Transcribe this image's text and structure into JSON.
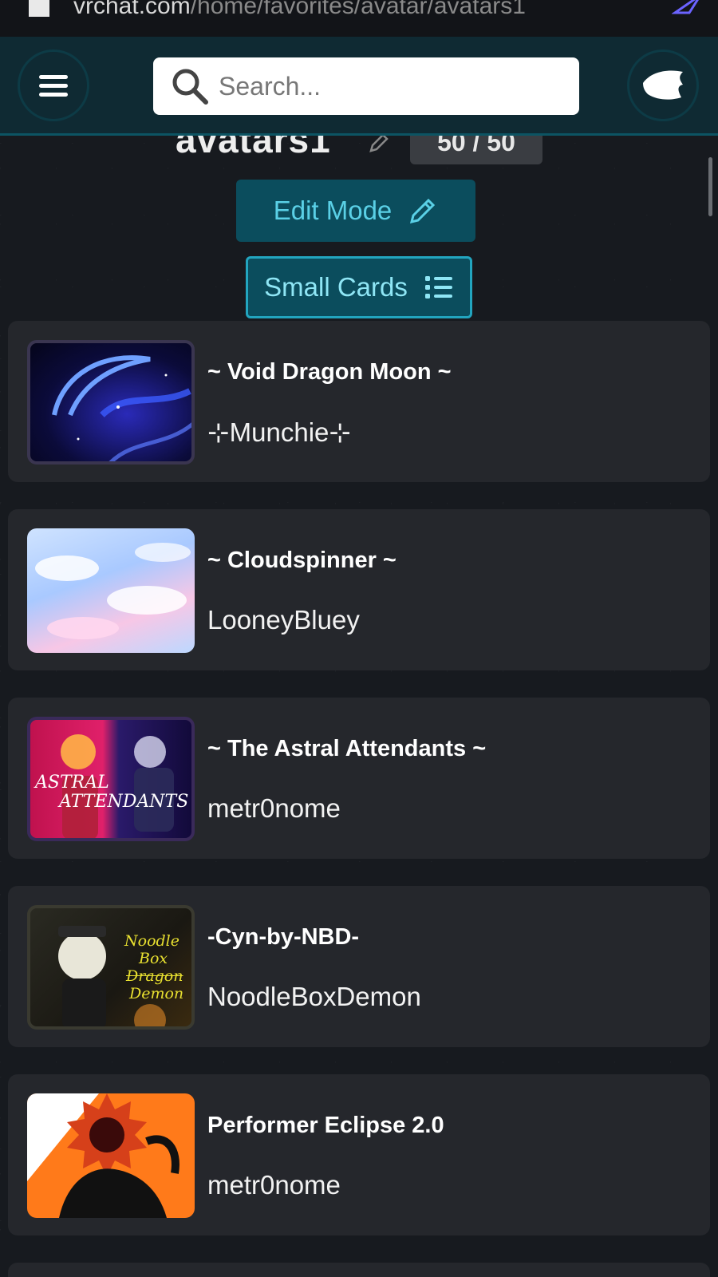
{
  "browser": {
    "url_host": "vrchat.com",
    "url_path": "/home/favorites/avatar/avatars1"
  },
  "header": {
    "search_placeholder": "Search..."
  },
  "favorites": {
    "title": "avatars1",
    "count": "50 / 50",
    "edit_mode_label": "Edit Mode",
    "small_cards_label": "Small Cards"
  },
  "avatars": [
    {
      "name": "~ Void Dragon Moon ~",
      "author": "⊹Munchie⊹"
    },
    {
      "name": "~ Cloudspinner ~",
      "author": "LooneyBluey"
    },
    {
      "name": "~ The Astral Attendants ~",
      "author": "metr0nome",
      "thumb_text_1": "ASTRAL",
      "thumb_text_2": "ATTENDANTS"
    },
    {
      "name": "-Cyn-by-NBD-",
      "author": "NoodleBoxDemon",
      "thumb_text_1": "Noodle",
      "thumb_text_2": "Box",
      "thumb_text_3": "Dragon",
      "thumb_text_4": "Demon"
    },
    {
      "name": "Performer Eclipse 2.0",
      "author": "metr0nome"
    }
  ],
  "colors": {
    "header_bg": "#0f2a33",
    "button_bg": "#0b4d5d",
    "accent": "#5ad0e6",
    "card_bg": "#25272c"
  },
  "icons": {
    "menu": "hamburger-icon",
    "search": "search-icon",
    "profile": "wing-icon",
    "edit": "pencil-icon",
    "cards": "list-icon"
  }
}
